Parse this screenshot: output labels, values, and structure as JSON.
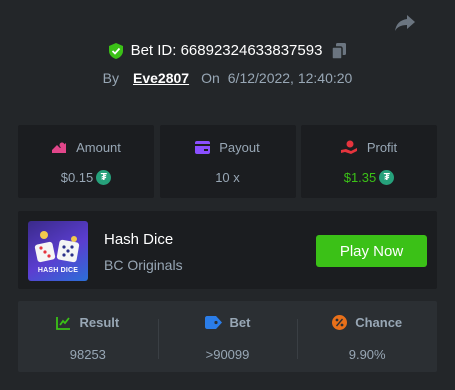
{
  "header": {
    "share_icon": "share-icon",
    "verified_icon": "shield-check-icon",
    "bet_id_label": "Bet ID:",
    "bet_id": "66892324633837593",
    "copy_icon": "copy-icon",
    "by_label": "By",
    "username": "Eve2807",
    "on_label": "On",
    "datetime": "6/12/2022, 12:40:20"
  },
  "stats": [
    {
      "label": "Amount",
      "value": "$0.15",
      "currency_icon": "usdt-icon",
      "icon": "amount-icon",
      "icon_color": "#e2468a"
    },
    {
      "label": "Payout",
      "value": "10 x",
      "icon": "wallet-icon",
      "icon_color": "#8a4fff"
    },
    {
      "label": "Profit",
      "value": "$1.35",
      "currency_icon": "usdt-icon",
      "icon": "profit-icon",
      "icon_color": "#e5343d",
      "value_color": "#3bc117"
    }
  ],
  "game": {
    "thumb_text": "HASH DICE",
    "name": "Hash Dice",
    "provider": "BC Originals",
    "play_label": "Play Now"
  },
  "result": [
    {
      "label": "Result",
      "value": "98253",
      "icon": "result-icon",
      "icon_color": "#3bc117"
    },
    {
      "label": "Bet",
      "value": ">90099",
      "icon": "bet-tag-icon",
      "icon_color": "#2b7de8"
    },
    {
      "label": "Chance",
      "value": "9.90%",
      "icon": "percent-icon",
      "icon_color": "#e8701a"
    }
  ],
  "colors": {
    "background": "#232629",
    "card": "#1b1d20",
    "accent_green": "#3bc117",
    "muted_text": "#98a7b5",
    "usdt": "#26a17b"
  }
}
